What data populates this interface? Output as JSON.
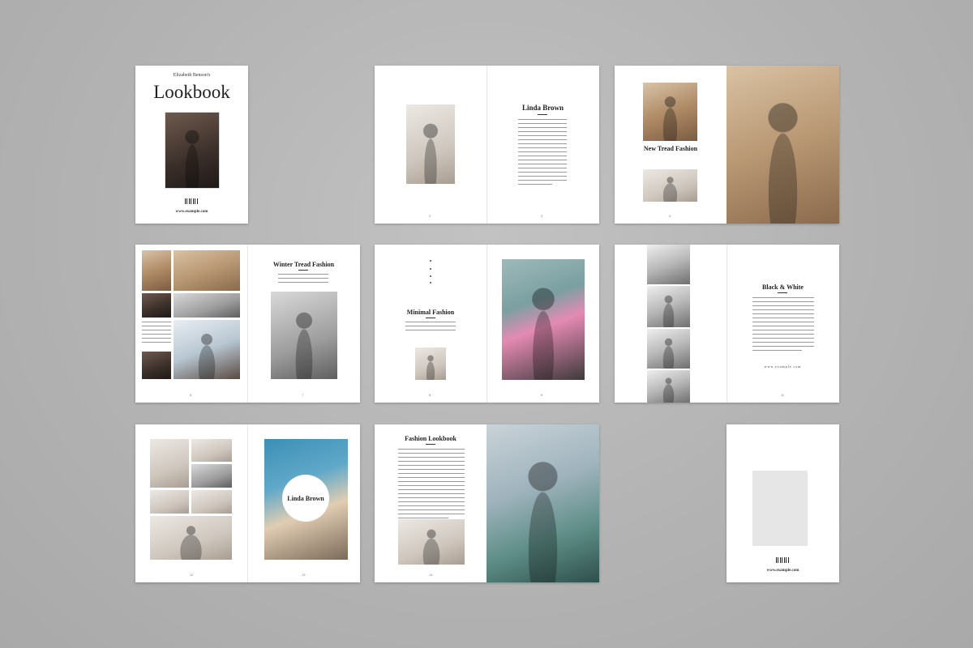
{
  "cover": {
    "author": "Elizabeth Benson's",
    "title": "Lookbook",
    "website": "www.example.com"
  },
  "spread2": {
    "heading": "Linda Brown"
  },
  "spread3": {
    "heading": "New Tread Fashion"
  },
  "spread4": {
    "heading": "Winter Tread Fashion"
  },
  "spread5": {
    "heading": "Minimal Fashion"
  },
  "spread6": {
    "heading": "Black & White",
    "website": "www.example.com"
  },
  "spread7": {
    "circle_name": "Linda Brown"
  },
  "spread8": {
    "heading": "Fashion Lookbook"
  },
  "back": {
    "website": "www.example.com"
  }
}
